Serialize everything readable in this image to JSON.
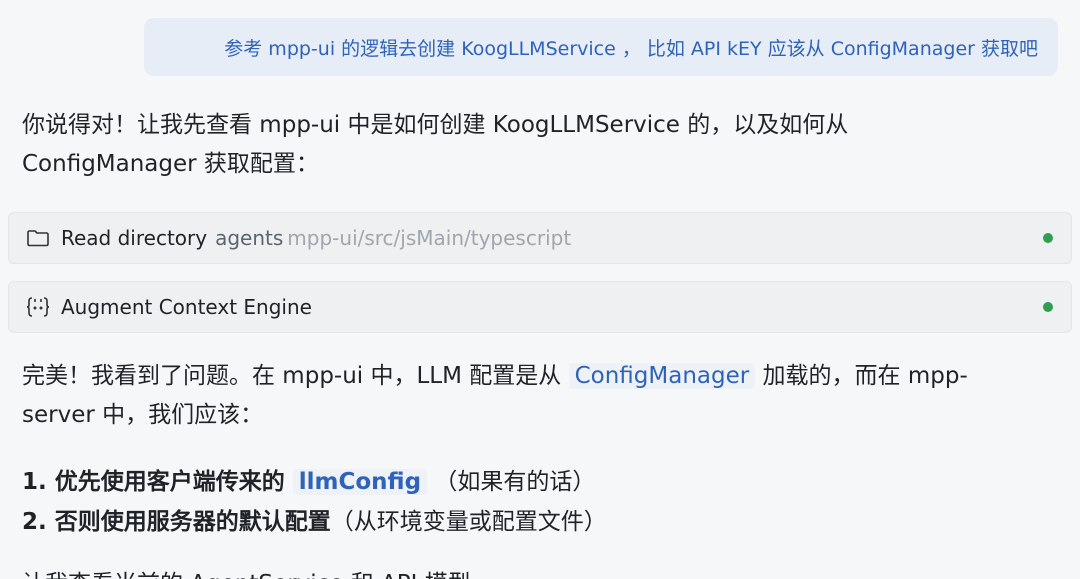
{
  "user_message": {
    "text": "参考  mpp-ui 的逻辑去创建 KoogLLMService ，  比如 API kEY 应该从 ConfigManager 获取吧"
  },
  "assistant": {
    "intro_line1": "你说得对！让我先查看 mpp-ui 中是如何创建 KoogLLMService 的，以及如何从",
    "intro_line2": "ConfigManager 获取配置：",
    "tools": [
      {
        "icon": "folder-icon",
        "name": "Read directory",
        "arg": "agents",
        "path": "mpp-ui/src/jsMain/typescript",
        "status_color": "#2f9e52"
      },
      {
        "icon": "code-braces-icon",
        "name": "Augment Context Engine",
        "status_color": "#2f9e52"
      }
    ],
    "perfect_part1": "完美！我看到了问题。在 mpp-ui 中，LLM 配置是从 ",
    "perfect_code": "ConfigManager",
    "perfect_part2": " 加载的，而在 mpp-",
    "perfect_line2": "server 中，我们应该：",
    "list": [
      {
        "prefix": "1. ",
        "bold": "优先使用客户端传来的 ",
        "code": "llmConfig",
        "suffix": " （如果有的话）"
      },
      {
        "prefix": "2. ",
        "bold": "否则使用服务器的默认配置",
        "suffix": "（从环境变量或配置文件）"
      }
    ],
    "cutoff_line": "让我查看当前的 AgentService 和 API 模型"
  }
}
